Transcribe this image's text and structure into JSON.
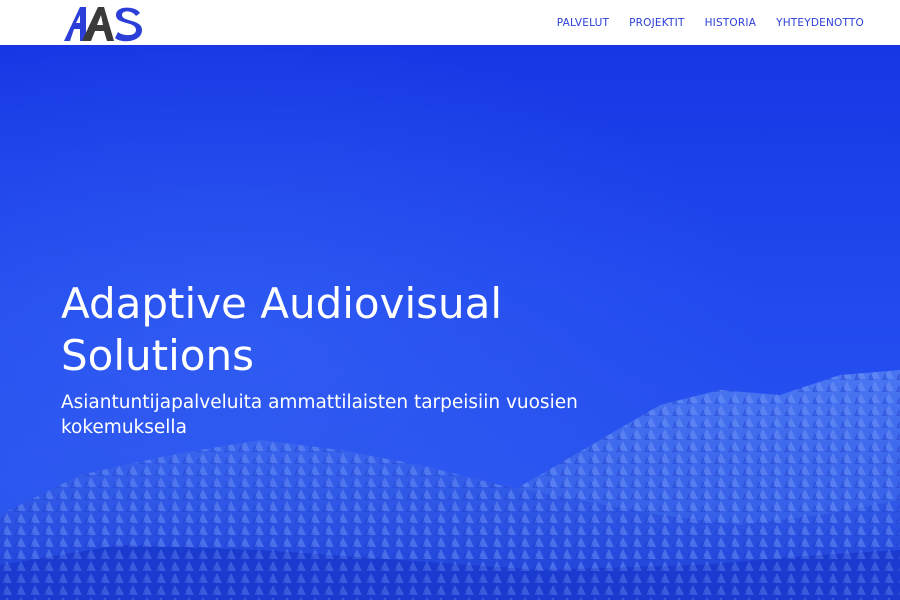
{
  "header": {
    "logo": {
      "icon": "aas-logo-icon",
      "text": "AAS",
      "colors": {
        "primary": "#2b3fd8",
        "secondary": "#4a4a4a"
      }
    },
    "nav": [
      {
        "label": "PALVELUT"
      },
      {
        "label": "PROJEKTIT"
      },
      {
        "label": "HISTORIA"
      },
      {
        "label": "YHTEYDENOTTO"
      }
    ]
  },
  "hero": {
    "title": "Adaptive Audiovisual Solutions",
    "subtitle": "Asiantuntijapalveluita ammattilaisten tarpeisiin vuosien kokemuksella",
    "background": "snowy-forest-mountain-image",
    "overlay_color": "#1f46ee"
  },
  "colors": {
    "accent": "#2b3fd8",
    "hero_blue": "#1f46ee",
    "text_on_hero": "#ffffff"
  }
}
